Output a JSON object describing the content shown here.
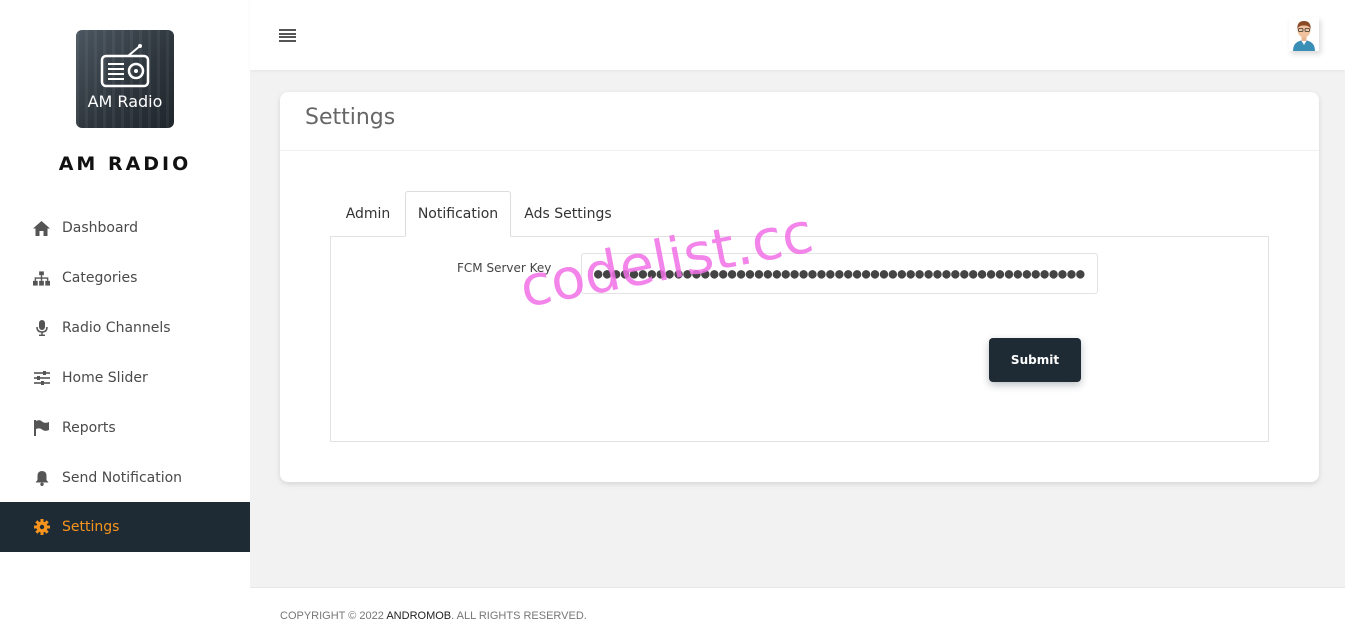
{
  "app": {
    "logo_text": "AM Radio",
    "brand_name": "AM RADIO"
  },
  "sidebar": {
    "items": [
      {
        "label": "Dashboard",
        "icon": "home-icon"
      },
      {
        "label": "Categories",
        "icon": "sitemap-icon"
      },
      {
        "label": "Radio Channels",
        "icon": "microphone-icon"
      },
      {
        "label": "Home Slider",
        "icon": "sliders-icon"
      },
      {
        "label": "Reports",
        "icon": "flag-icon"
      },
      {
        "label": "Send Notification",
        "icon": "bell-icon"
      },
      {
        "label": "Settings",
        "icon": "gear-icon",
        "active": true
      }
    ],
    "active_color": "#f7941d",
    "active_bg": "#1e2b34"
  },
  "topbar": {
    "menu_icon": "hamburger-icon",
    "avatar_icon": "user-avatar-icon"
  },
  "page": {
    "title": "Settings",
    "tabs": [
      {
        "label": "Admin"
      },
      {
        "label": "Notification",
        "active": true
      },
      {
        "label": "Ads Settings"
      }
    ],
    "form": {
      "fcm_label": "FCM Server Key",
      "fcm_value": "●●●●●●●●●●●●●●●●●●●●●●●●●●●●●●●●●●●●●●●●●●●●●●●●●●●●●●●●●●",
      "submit_label": "Submit"
    }
  },
  "watermark": "codelist.cc",
  "footer": {
    "prefix": "COPYRIGHT © 2022 ",
    "company": "ANDROMOB",
    "suffix": ". ALL RIGHTS RESERVED."
  }
}
